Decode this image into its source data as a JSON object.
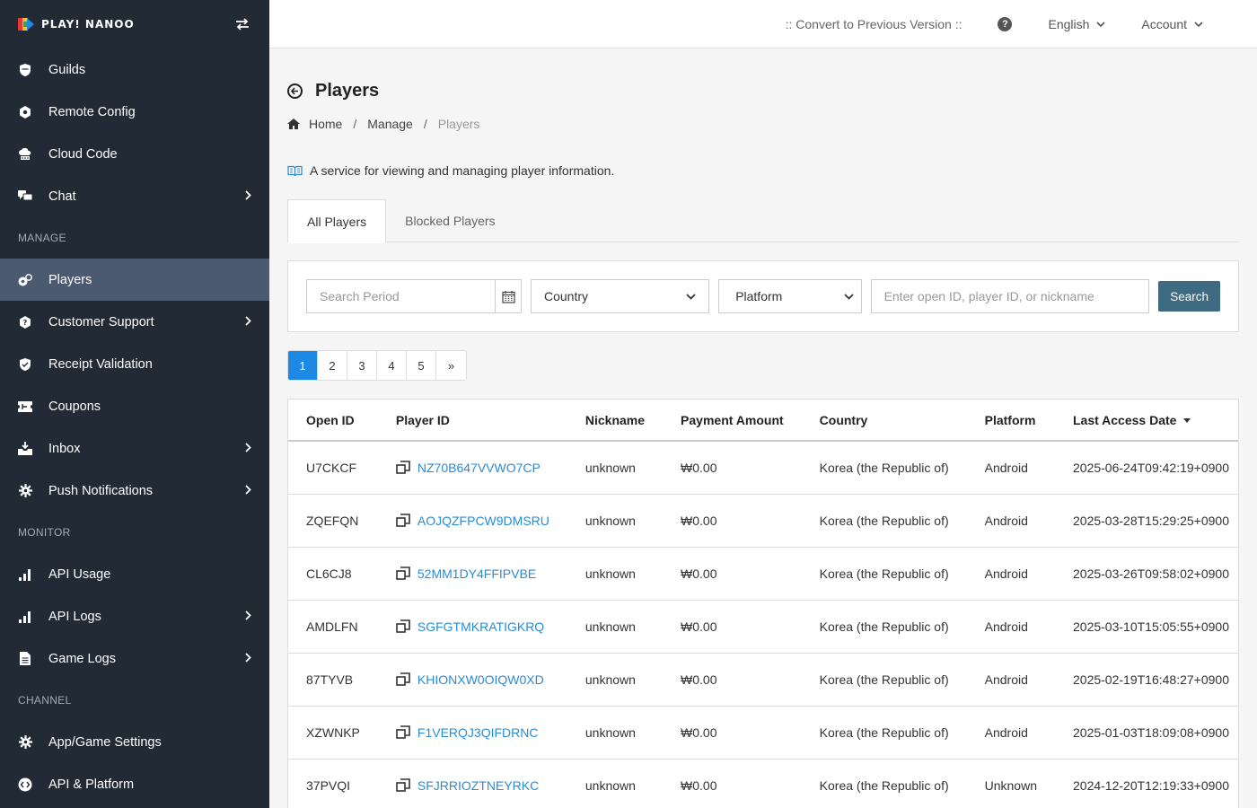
{
  "brand": {
    "logo_text": "PLAY! NANOO"
  },
  "sidebar": {
    "groups": [
      {
        "items": [
          {
            "label": "Guilds",
            "icon": "shield-icon"
          },
          {
            "label": "Remote Config",
            "icon": "config-icon"
          },
          {
            "label": "Cloud Code",
            "icon": "cloud-icon"
          },
          {
            "label": "Chat",
            "icon": "chat-icon",
            "has_submenu": true
          }
        ]
      },
      {
        "section": "MANAGE",
        "items": [
          {
            "label": "Players",
            "icon": "players-icon",
            "active": true
          },
          {
            "label": "Customer Support",
            "icon": "support-icon",
            "has_submenu": true
          },
          {
            "label": "Receipt Validation",
            "icon": "shield-check-icon"
          },
          {
            "label": "Coupons",
            "icon": "coupon-icon"
          },
          {
            "label": "Inbox",
            "icon": "inbox-icon",
            "has_submenu": true
          },
          {
            "label": "Push Notifications",
            "icon": "gear-icon",
            "has_submenu": true
          }
        ]
      },
      {
        "section": "MONITOR",
        "items": [
          {
            "label": "API Usage",
            "icon": "bar-chart-icon"
          },
          {
            "label": "API Logs",
            "icon": "bar-chart-icon",
            "has_submenu": true
          },
          {
            "label": "Game Logs",
            "icon": "document-icon",
            "has_submenu": true
          }
        ]
      },
      {
        "section": "CHANNEL",
        "items": [
          {
            "label": "App/Game Settings",
            "icon": "gear-icon"
          },
          {
            "label": "API & Platform",
            "icon": "api-icon"
          }
        ]
      }
    ]
  },
  "topbar": {
    "convert_label": ":: Convert to Previous Version ::",
    "language": "English",
    "account": "Account"
  },
  "page": {
    "title": "Players",
    "breadcrumb": {
      "home": "Home",
      "manage": "Manage",
      "current": "Players"
    },
    "description": "A service for viewing and managing player information."
  },
  "tabs": {
    "all": "All Players",
    "blocked": "Blocked Players"
  },
  "filter": {
    "period_placeholder": "Search Period",
    "country": "Country",
    "platform": "Platform",
    "search_placeholder": "Enter open ID, player ID, or nickname",
    "search_button": "Search"
  },
  "pagination": {
    "pages": [
      "1",
      "2",
      "3",
      "4",
      "5"
    ],
    "next": "»",
    "current": "1"
  },
  "table": {
    "headers": [
      "Open ID",
      "Player ID",
      "Nickname",
      "Payment Amount",
      "Country",
      "Platform",
      "Last Access Date"
    ],
    "rows": [
      {
        "open_id": "U7CKCF",
        "player_id": "NZ70B647VVWO7CP",
        "nickname": "unknown",
        "payment": "₩0.00",
        "country": "Korea (the Republic of)",
        "platform": "Android",
        "last_access": "2025-06-24T09:42:19+0900"
      },
      {
        "open_id": "ZQEFQN",
        "player_id": "AOJQZFPCW9DMSRU",
        "nickname": "unknown",
        "payment": "₩0.00",
        "country": "Korea (the Republic of)",
        "platform": "Android",
        "last_access": "2025-03-28T15:29:25+0900"
      },
      {
        "open_id": "CL6CJ8",
        "player_id": "52MM1DY4FFIPVBE",
        "nickname": "unknown",
        "payment": "₩0.00",
        "country": "Korea (the Republic of)",
        "platform": "Android",
        "last_access": "2025-03-26T09:58:02+0900"
      },
      {
        "open_id": "AMDLFN",
        "player_id": "SGFGTMKRATIGKRQ",
        "nickname": "unknown",
        "payment": "₩0.00",
        "country": "Korea (the Republic of)",
        "platform": "Android",
        "last_access": "2025-03-10T15:05:55+0900"
      },
      {
        "open_id": "87TYVB",
        "player_id": "KHIONXW0OIQW0XD",
        "nickname": "unknown",
        "payment": "₩0.00",
        "country": "Korea (the Republic of)",
        "platform": "Android",
        "last_access": "2025-02-19T16:48:27+0900"
      },
      {
        "open_id": "XZWNKP",
        "player_id": "F1VERQJ3QIFDRNC",
        "nickname": "unknown",
        "payment": "₩0.00",
        "country": "Korea (the Republic of)",
        "platform": "Android",
        "last_access": "2025-01-03T18:09:08+0900"
      },
      {
        "open_id": "37PVQI",
        "player_id": "SFJRRIOZTNEYRKC",
        "nickname": "unknown",
        "payment": "₩0.00",
        "country": "Korea (the Republic of)",
        "platform": "Unknown",
        "last_access": "2024-12-20T12:19:33+0900"
      }
    ]
  },
  "colors": {
    "sidebar_bg": "#222a36",
    "sidebar_active": "#4b5a71",
    "link": "#2a8bd6",
    "button": "#3f6b82",
    "page_active": "#1e88e5"
  }
}
